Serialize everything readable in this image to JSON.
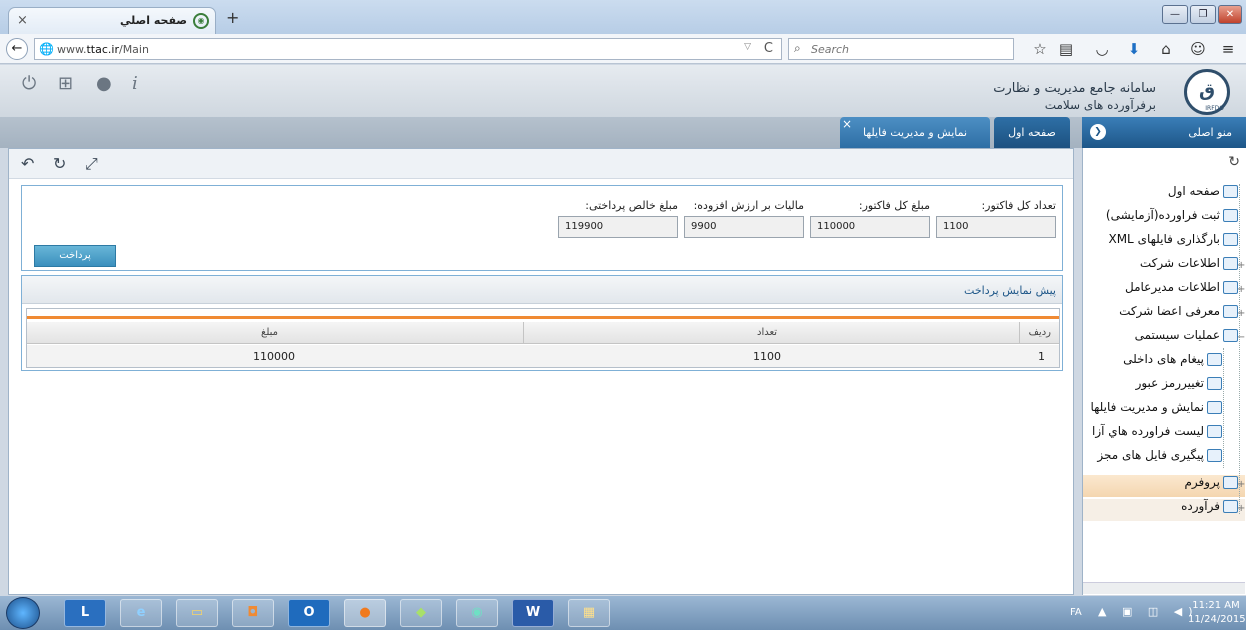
{
  "browser": {
    "tab_title": "صفحه اصلي",
    "tab_close": "×",
    "new_tab": "+",
    "url_prefix": "www.",
    "url_domain": "ttac.ir",
    "url_path": "/Main",
    "search_placeholder": "Search",
    "window_buttons": {
      "minimize": "—",
      "restore": "❐",
      "close": "✕"
    }
  },
  "app": {
    "title_line1": "سامانه جامع مدیریت و نظارت",
    "title_line2": "برفرآورده های سلامت",
    "logo_text": "IRFDO"
  },
  "tabs": {
    "home": "صفحه اول",
    "files": "نمایش و مدیریت فایلها",
    "close": "×"
  },
  "sidebar": {
    "title": "منو اصلی",
    "items": [
      {
        "label": "صفحه اول",
        "expander": ""
      },
      {
        "label": "ثبت فراورده(آزمایشی)",
        "expander": ""
      },
      {
        "label": "بارگذاری فایلهای XML",
        "expander": ""
      },
      {
        "label": "اطلاعات شرکت",
        "expander": "+"
      },
      {
        "label": "اطلاعات مدیرعامل",
        "expander": "+"
      },
      {
        "label": "معرفی اعضا شرکت",
        "expander": "+"
      },
      {
        "label": "عملیات سیستمی",
        "expander": "−"
      },
      {
        "label": "پیغام های داخلی",
        "expander": ""
      },
      {
        "label": "تغییررمز عبور",
        "expander": ""
      },
      {
        "label": "نمایش و مدیریت فایلها",
        "expander": ""
      },
      {
        "label": "لیست فراورده هاي آزا",
        "expander": ""
      },
      {
        "label": "پیگیری فایل های مجز",
        "expander": ""
      },
      {
        "label": "پروفرم",
        "expander": "+"
      },
      {
        "label": "فرآورده",
        "expander": "+"
      }
    ]
  },
  "summary": {
    "total_count_label": "تعداد کل فاکتور:",
    "total_count_value": "1100",
    "total_amount_label": "مبلغ کل فاکتور:",
    "total_amount_value": "110000",
    "vat_label": "مالیات بر ارزش افزوده:",
    "vat_value": "9900",
    "net_label": "مبلغ خالص پرداختی:",
    "net_value": "119900",
    "pay_button": "پرداخت"
  },
  "preview": {
    "title": "پیش نمایش پرداخت",
    "columns": {
      "row": "ردیف",
      "count": "تعداد",
      "amount": "مبلغ"
    },
    "rows": [
      {
        "row": "1",
        "count": "1100",
        "amount": "110000"
      }
    ]
  },
  "taskbar": {
    "lang": "FA",
    "time": "11:21 AM",
    "date": "11/24/2015"
  }
}
